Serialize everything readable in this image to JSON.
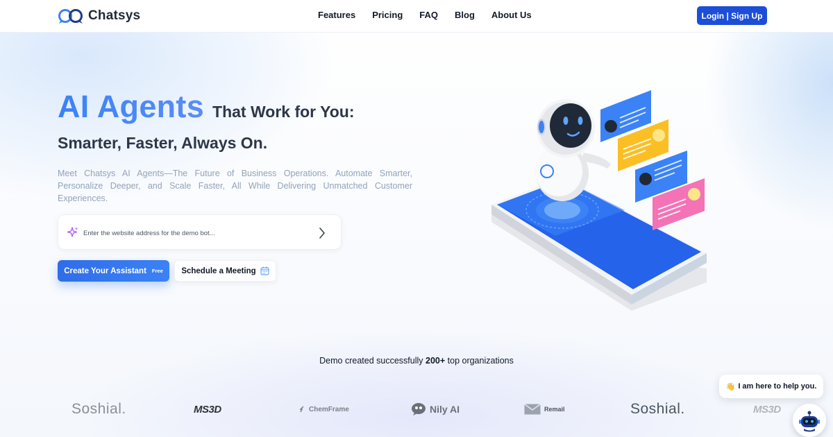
{
  "brand": {
    "name": "Chatsys"
  },
  "nav": [
    {
      "label": "Features"
    },
    {
      "label": "Pricing"
    },
    {
      "label": "FAQ"
    },
    {
      "label": "Blog"
    },
    {
      "label": "About Us"
    }
  ],
  "header": {
    "login_label": "Login | Sign Up"
  },
  "hero": {
    "title_highlight": "AI Agents",
    "title_rest": "That Work for You:",
    "subtitle": "Smarter, Faster, Always On.",
    "description": "Meet Chatsys AI Agents—The Future of Business Operations. Automate Smarter, Personalize Deeper, and Scale Faster, All While Delivering Unmatched Customer Experiences."
  },
  "search": {
    "placeholder": "Enter the website address for the demo bot..."
  },
  "buttons": {
    "create_label": "Create Your Assistant",
    "create_badge": "Free",
    "meeting_label": "Schedule a Meeting"
  },
  "social_proof": {
    "prefix": "Demo created successfully",
    "count": "200+",
    "suffix": "top organizations"
  },
  "logos": [
    {
      "name": "Soshial."
    },
    {
      "name": "MS3D"
    },
    {
      "name": "ChemFrame"
    },
    {
      "name": "Nily AI"
    },
    {
      "name": "Remail"
    },
    {
      "name": "Soshial."
    },
    {
      "name": "MS3D"
    }
  ],
  "chat_widget": {
    "greeting": "I am here to help you.",
    "emoji": "👋"
  },
  "colors": {
    "primary": "#1d4ed8",
    "accent": "#3b82f6",
    "text_dark": "#2d3748",
    "text_muted": "#94a3b8"
  },
  "icons": [
    "chatsys-logo-icon",
    "sparkle-icon",
    "chevron-right-icon",
    "calendar-icon",
    "robot-icon"
  ]
}
